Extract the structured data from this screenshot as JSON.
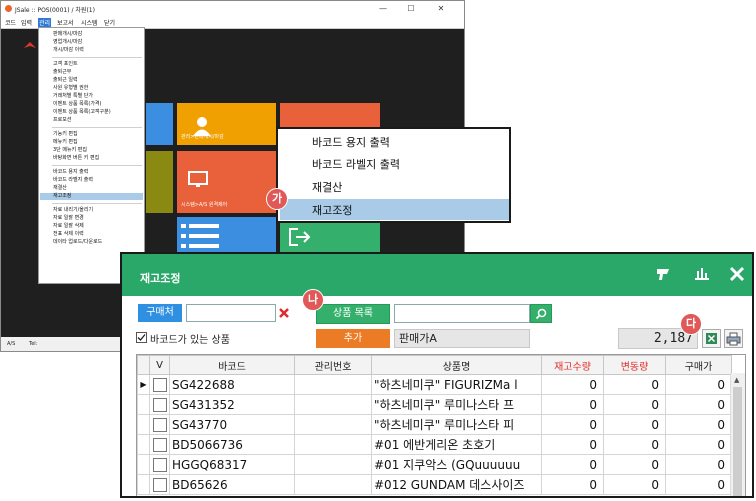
{
  "app": {
    "title": "JSale  ::  POS(0001) / 차원(1)",
    "window_buttons": [
      "—",
      "☐",
      "✕"
    ],
    "menu": [
      "코드",
      "입력",
      "관리",
      "보고서",
      "시스템",
      "닫기"
    ],
    "active_menu_index": 2,
    "status": {
      "left": "A/S",
      "right": "Tel:"
    }
  },
  "tiles": [
    {
      "label": "관리>판매개시/마감",
      "color": "#f0a000",
      "icon": "person-icon"
    },
    {
      "label": "시스템>A/S 원격제어",
      "color": "#e8613a",
      "icon": "monitor-icon"
    }
  ],
  "dropdown": {
    "groups": [
      [
        "판매개시/마감",
        "영업개시/마감",
        "개시/마감 이력"
      ],
      [
        "고객 포인트",
        "출퇴근부",
        "출퇴근 일력",
        "사원 유형별 권한",
        "거래처별 특별 단가",
        "이벤트 상품 목록(가격)",
        "이벤트 상품 목록(고객구분)",
        "프로모션"
      ],
      [
        "기능키 편집",
        "메뉴키 편집",
        "3단 메뉴키 편집",
        "바탕화면 버튼 키 편집"
      ],
      [
        "바코드 용지 출력",
        "바코드 라벨지 출력",
        "재결산",
        "재고조정"
      ],
      [
        "자료 내리기/올리기",
        "자료 일괄 변경",
        "자료 일괄 삭제",
        "전표 삭제 이력",
        "데이타 업로드/다운로드"
      ]
    ],
    "highlighted": "재고조정"
  },
  "popup": {
    "items": [
      "바코드 용지 출력",
      "바코드 라벨지 출력",
      "재결산",
      "재고조정"
    ],
    "highlighted_index": 3
  },
  "callouts": {
    "ga": "가",
    "na": "나",
    "da": "다"
  },
  "inventory": {
    "title": "재고조정",
    "header_icons": [
      "scanner-icon",
      "bar-chart-icon",
      "close-icon"
    ],
    "buyer_button": "구매처",
    "product_list_button": "상품 목록",
    "add_button": "추가",
    "barcode_only_label": "바코드가 있는 상품",
    "price_field": "판매가A",
    "count": "2,187",
    "columns": [
      "V",
      "바코드",
      "관리번호",
      "상품명",
      "재고수량",
      "변동량",
      "구매가"
    ],
    "red_columns": [
      "재고수량",
      "변동량"
    ],
    "rows": [
      {
        "barcode": "SG422688",
        "mgmt": "",
        "name": "\"하츠네미쿠\" FIGURIZMa l",
        "stock": "0",
        "change": "0",
        "cost": "0"
      },
      {
        "barcode": "SG431352",
        "mgmt": "",
        "name": "\"하츠네미쿠\" 루미나스타 프",
        "stock": "0",
        "change": "0",
        "cost": "0"
      },
      {
        "barcode": "SG43770",
        "mgmt": "",
        "name": "\"하츠네미쿠\" 루미나스타 피",
        "stock": "0",
        "change": "0",
        "cost": "0"
      },
      {
        "barcode": "BD5066736",
        "mgmt": "",
        "name": "#01 에반게리온 초호기",
        "stock": "0",
        "change": "0",
        "cost": "0"
      },
      {
        "barcode": "HGGQ68317",
        "mgmt": "",
        "name": "#01 지쿠악스 (GQuuuuuu",
        "stock": "0",
        "change": "0",
        "cost": "0"
      },
      {
        "barcode": "BD65626",
        "mgmt": "",
        "name": "#012 GUNDAM 데스사이즈",
        "stock": "0",
        "change": "0",
        "cost": "0"
      }
    ],
    "current_row_marker": "▶"
  }
}
